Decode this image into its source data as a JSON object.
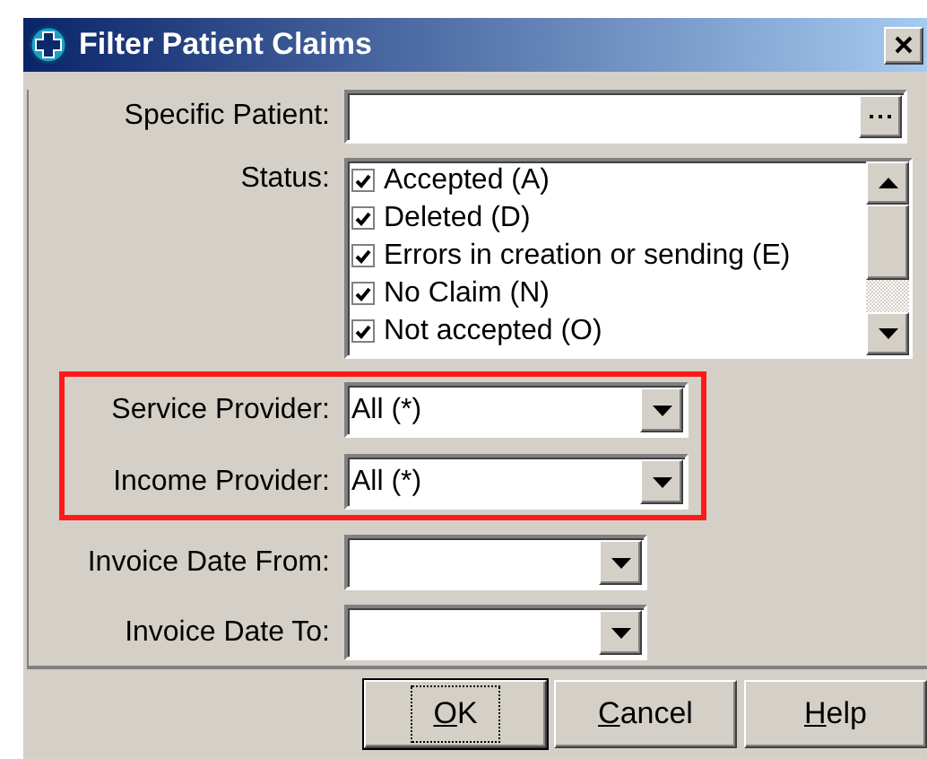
{
  "window": {
    "title": "Filter Patient Claims"
  },
  "fields": [
    {
      "kind": "browse",
      "label": "Specific Patient:",
      "highlighted": false
    },
    {
      "kind": "checklist",
      "label": "Status:",
      "highlighted": false,
      "items": [
        {
          "label": "Accepted (A)",
          "checked": true
        },
        {
          "label": "Deleted (D)",
          "checked": true
        },
        {
          "label": "Errors in creation or sending (E)",
          "checked": true
        },
        {
          "label": "No Claim (N)",
          "checked": true
        },
        {
          "label": "Not accepted (O)",
          "checked": true
        }
      ]
    },
    {
      "kind": "combo",
      "label": "Service Provider:",
      "value": "All (*)",
      "highlighted": true,
      "wide": true
    },
    {
      "kind": "combo",
      "label": "Income Provider:",
      "value": "All (*)",
      "highlighted": true,
      "wide": true
    },
    {
      "kind": "combo",
      "label": "Invoice Date From:",
      "highlighted": false,
      "wide": false
    },
    {
      "kind": "combo",
      "label": "Invoice Date To:",
      "highlighted": false,
      "wide": false
    }
  ],
  "buttons": [
    {
      "label": "OK",
      "default": true
    },
    {
      "label": "Cancel",
      "default": false
    },
    {
      "label": "Help",
      "default": false
    }
  ]
}
